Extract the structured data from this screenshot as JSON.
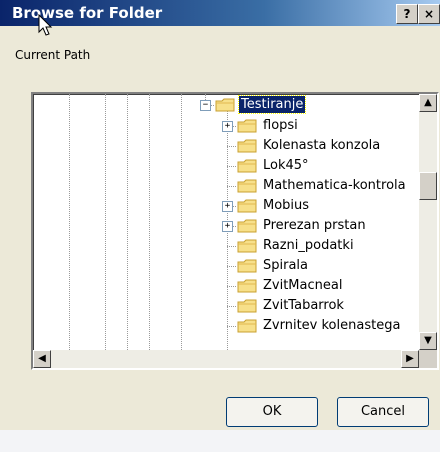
{
  "window": {
    "title": "Browse for Folder",
    "help_label": "?",
    "close_label": "×"
  },
  "current_path_label": "Current Path",
  "tree": {
    "items": [
      {
        "label": "Testiranje",
        "selected": true,
        "expander": "minus"
      },
      {
        "label": "flopsi",
        "expander": "plus"
      },
      {
        "label": "Kolenasta konzola"
      },
      {
        "label": "Lok45°"
      },
      {
        "label": "Mathematica-kontrola"
      },
      {
        "label": "Mobius",
        "expander": "plus"
      },
      {
        "label": "Prerezan prstan",
        "expander": "plus"
      },
      {
        "label": "Razni_podatki"
      },
      {
        "label": "Spirala"
      },
      {
        "label": "ZvitMacneal"
      },
      {
        "label": "ZvitTabarrok"
      },
      {
        "label": "Zvrnitev kolenastega"
      }
    ]
  },
  "scroll": {
    "up": "▲",
    "down": "▼",
    "left": "◀",
    "right": "▶"
  },
  "buttons": {
    "ok": "OK",
    "cancel": "Cancel"
  }
}
